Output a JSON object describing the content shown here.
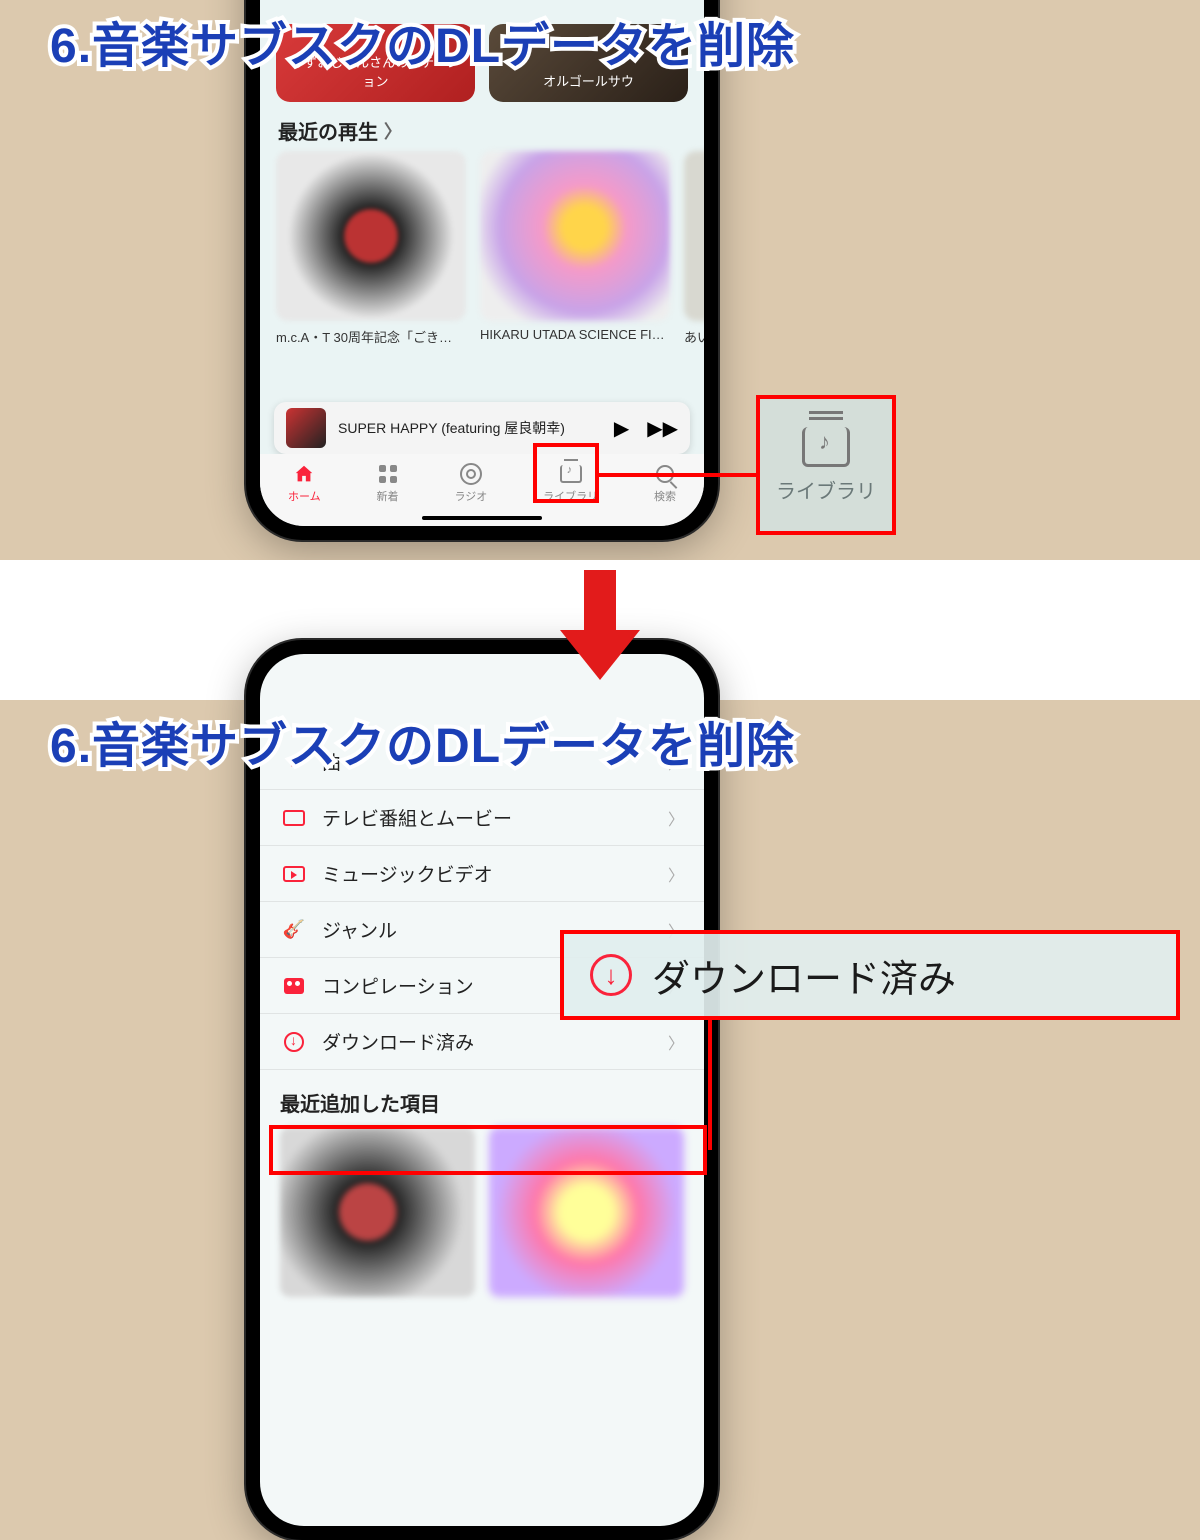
{
  "step_title": "6.音楽サブスクのDLデータを削除",
  "top": {
    "hero1_text": "みずおじさんさんのステーション",
    "hero2_text": "オルゴールサウ",
    "recent_section": "最近の再生",
    "album1": "m.c.A・T 30周年記念「ごき…",
    "album2": "HIKARU UTADA SCIENCE FI…",
    "album3": "あいっ! - …",
    "now_playing": "SUPER HAPPY (featuring 屋良朝幸)",
    "tabs": {
      "home": "ホーム",
      "new": "新着",
      "radio": "ラジオ",
      "library": "ライブラリ",
      "search": "検索"
    },
    "callout_label": "ライブラリ"
  },
  "bottom": {
    "items": {
      "songs": "曲",
      "tv": "テレビ番組とムービー",
      "mv": "ミュージックビデオ",
      "genre": "ジャンル",
      "comp": "コンピレーション",
      "downloaded": "ダウンロード済み"
    },
    "recent_added": "最近追加した項目",
    "callout_text": "ダウンロード済み"
  }
}
